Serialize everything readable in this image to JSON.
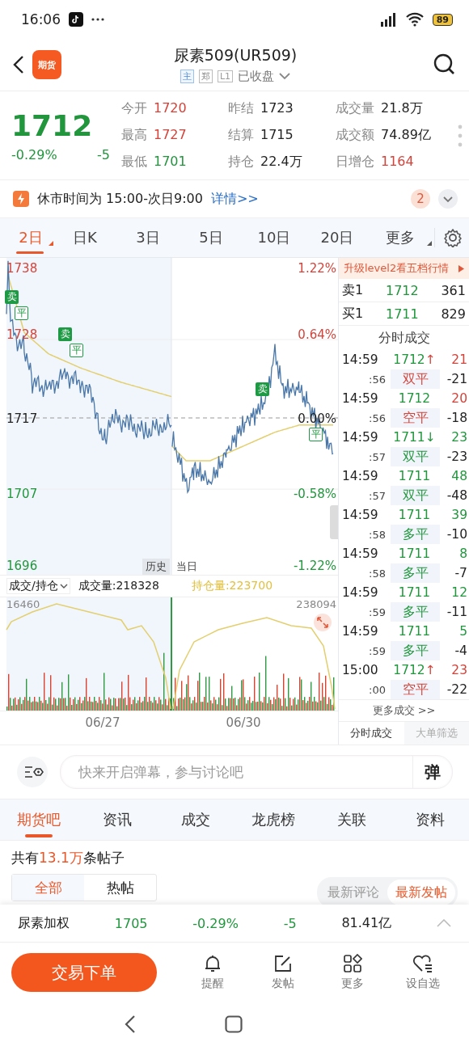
{
  "status_bar": {
    "time": "16:06",
    "battery": "89"
  },
  "header": {
    "logo_text": "期货",
    "title": "尿素509(UR509)",
    "badges": [
      {
        "label": "主",
        "kind": "main"
      },
      {
        "label": "郑",
        "kind": "exchange"
      },
      {
        "label": "L1",
        "kind": "level"
      }
    ],
    "market_status": "已收盘"
  },
  "quote": {
    "price": "1712",
    "change_pct": "-0.29%",
    "change": "-5",
    "color": "#21963d",
    "stats": [
      {
        "label": "今开",
        "value": "1720",
        "color": "#d4433a"
      },
      {
        "label": "昨结",
        "value": "1723",
        "color": "#222222"
      },
      {
        "label": "成交量",
        "value": "21.8万",
        "color": "#222222"
      },
      {
        "label": "最高",
        "value": "1727",
        "color": "#d4433a"
      },
      {
        "label": "结算",
        "value": "1715",
        "color": "#222222"
      },
      {
        "label": "成交额",
        "value": "74.89亿",
        "color": "#222222"
      },
      {
        "label": "最低",
        "value": "1701",
        "color": "#21963d"
      },
      {
        "label": "持仓",
        "value": "22.4万",
        "color": "#222222"
      },
      {
        "label": "日增仓",
        "value": "1164",
        "color": "#d4433a"
      }
    ]
  },
  "notice": {
    "text": "休市时间为 15:00-次日9:00",
    "link": "详情>>",
    "count": "2"
  },
  "periods": [
    {
      "label": "2日",
      "selected": true,
      "dropdown": true
    },
    {
      "label": "日K",
      "selected": false,
      "dropdown": false
    },
    {
      "label": "3日",
      "selected": false,
      "dropdown": false
    },
    {
      "label": "5日",
      "selected": false,
      "dropdown": false
    },
    {
      "label": "10日",
      "selected": false,
      "dropdown": false
    },
    {
      "label": "20日",
      "selected": false,
      "dropdown": false
    },
    {
      "label": "更多",
      "selected": false,
      "dropdown": true
    }
  ],
  "price_chart": {
    "left_labels": [
      {
        "text": "1738",
        "color": "#d4433a"
      },
      {
        "text": "1728",
        "color": "#d4433a"
      },
      {
        "text": "1717",
        "color": "#222222"
      },
      {
        "text": "1707",
        "color": "#21963d"
      },
      {
        "text": "1696",
        "color": "#21963d"
      }
    ],
    "right_labels": [
      {
        "text": "1.22%",
        "color": "#d4433a"
      },
      {
        "text": "0.64%",
        "color": "#d4433a"
      },
      {
        "text": "0.00%",
        "color": "#222222"
      },
      {
        "text": "-0.58%",
        "color": "#21963d"
      },
      {
        "text": "-1.22%",
        "color": "#21963d"
      }
    ],
    "markers": [
      {
        "label": "卖",
        "kind": "sell"
      },
      {
        "label": "平",
        "kind": "close"
      },
      {
        "label": "卖",
        "kind": "sell"
      },
      {
        "label": "平",
        "kind": "close"
      },
      {
        "label": "卖",
        "kind": "sell"
      },
      {
        "label": "平",
        "kind": "close"
      }
    ],
    "history_tab": "历史",
    "today_tab": "当日"
  },
  "volume_chart": {
    "selector": "成交/持仓",
    "volume": "成交量:218328",
    "open_interest": "持仓量:223700",
    "left_max": "16460",
    "right_max": "238094",
    "dates": [
      "06/27",
      "06/30"
    ]
  },
  "depth": {
    "banner": "升级level2看五档行情",
    "rows": [
      {
        "label": "卖1",
        "price": "1712",
        "volume": "361"
      },
      {
        "label": "买1",
        "price": "1711",
        "volume": "829"
      }
    ],
    "title": "分时成交",
    "trades": [
      {
        "time": "14:59",
        "seconds": ":56",
        "price": "1712",
        "arrow": "↑",
        "volume": "21",
        "color": "#d4433a",
        "type": "双平",
        "change": "-21"
      },
      {
        "time": "14:59",
        "seconds": ":56",
        "price": "1712",
        "volume": "20",
        "color": "#d4433a",
        "type": "空平",
        "change": "-18"
      },
      {
        "time": "14:59",
        "seconds": ":57",
        "price": "1711",
        "arrow": "↓",
        "volume": "23",
        "color": "#21963d",
        "type": "双平",
        "change": "-23"
      },
      {
        "time": "14:59",
        "seconds": ":57",
        "price": "1711",
        "volume": "48",
        "color": "#21963d",
        "type": "双平",
        "change": "-48"
      },
      {
        "time": "14:59",
        "seconds": ":58",
        "price": "1711",
        "volume": "39",
        "color": "#21963d",
        "type": "多平",
        "change": "-10"
      },
      {
        "time": "14:59",
        "seconds": ":58",
        "price": "1711",
        "volume": "8",
        "color": "#21963d",
        "type": "多平",
        "change": "-7"
      },
      {
        "time": "14:59",
        "seconds": ":59",
        "price": "1711",
        "volume": "12",
        "color": "#21963d",
        "type": "多平",
        "change": "-11"
      },
      {
        "time": "14:59",
        "seconds": ":59",
        "price": "1711",
        "volume": "5",
        "color": "#21963d",
        "type": "多平",
        "change": "-4"
      },
      {
        "time": "15:00",
        "seconds": ":00",
        "price": "1712",
        "arrow": "↑",
        "volume": "23",
        "color": "#d4433a",
        "type": "空平",
        "change": "-22"
      }
    ],
    "more": "更多成交 >>",
    "tabs": [
      {
        "label": "分时成交",
        "selected": true
      },
      {
        "label": "大单筛选",
        "selected": false
      }
    ]
  },
  "discussion": {
    "placeholder": "快来开启弹幕，参与讨论吧",
    "send": "弹"
  },
  "content_tabs": [
    {
      "label": "期货吧",
      "selected": true
    },
    {
      "label": "资讯",
      "selected": false
    },
    {
      "label": "成交",
      "selected": false
    },
    {
      "label": "龙虎榜",
      "selected": false
    },
    {
      "label": "关联",
      "selected": false
    },
    {
      "label": "资料",
      "selected": false
    }
  ],
  "post_count": {
    "prefix": "共有",
    "count": "13.1万",
    "suffix": "条帖子"
  },
  "filters": {
    "left": [
      {
        "label": "全部",
        "selected": true
      },
      {
        "label": "热帖",
        "selected": false
      }
    ],
    "right": [
      {
        "label": "最新评论",
        "selected": false
      },
      {
        "label": "最新发帖",
        "selected": true
      }
    ]
  },
  "weighted": {
    "name": "尿素加权",
    "price": "1705",
    "change_pct": "-0.29%",
    "change": "-5",
    "amount": "81.41亿",
    "color": "#21963d"
  },
  "actions": {
    "trade": "交易下单",
    "items": [
      {
        "label": "提醒",
        "kind": "alert"
      },
      {
        "label": "发帖",
        "kind": "post"
      },
      {
        "label": "更多",
        "kind": "more"
      },
      {
        "label": "设自选",
        "kind": "watch"
      }
    ]
  }
}
